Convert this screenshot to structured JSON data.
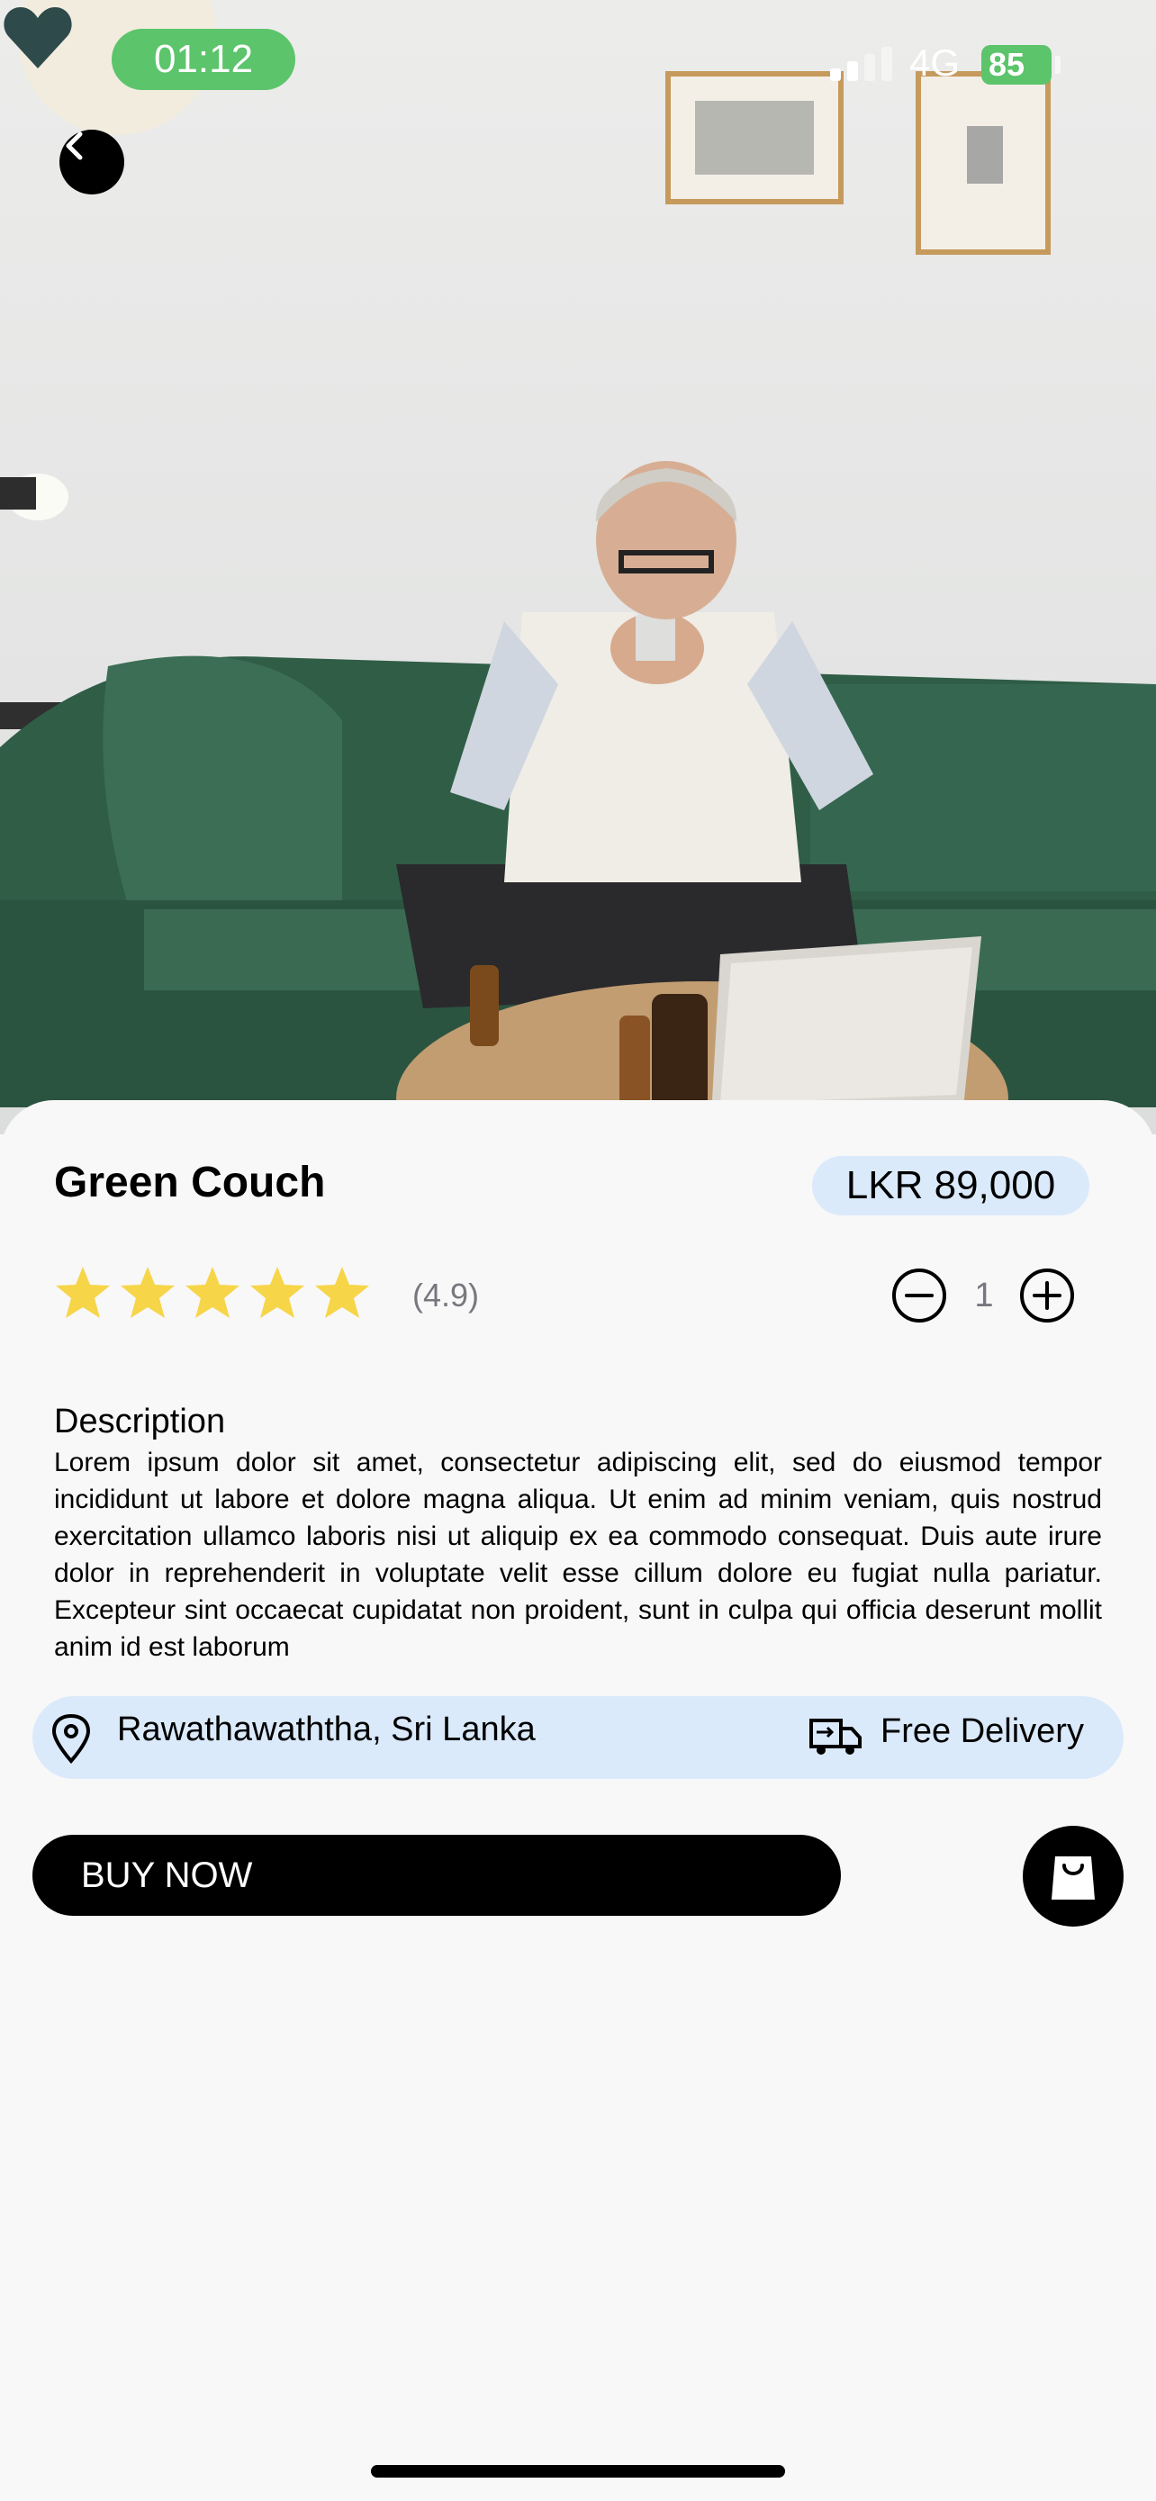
{
  "status_bar": {
    "time": "01:12",
    "network": "4G",
    "battery": "85"
  },
  "hero": {
    "back_icon": "chevron-left-icon",
    "favorite_icon": "heart-icon"
  },
  "product": {
    "title": "Green Couch",
    "price": "LKR 89,000",
    "rating_text": "(4.9)",
    "stars": 5,
    "quantity": "1"
  },
  "description": {
    "heading": "Description",
    "body": "Lorem ipsum dolor sit amet, consectetur adipiscing elit, sed do eiusmod tempor incididunt ut labore et dolore magna aliqua. Ut enim ad minim veniam, quis nostrud exercitation ullamco laboris nisi ut aliquip ex ea commodo consequat. Duis aute irure dolor in reprehenderit in voluptate velit esse cillum dolore eu fugiat nulla pariatur. Excepteur sint occaecat cupidatat non proident, sunt in culpa qui officia deserunt mollit anim id est laborum"
  },
  "info": {
    "location": "Rawathawaththa, Sri Lanka",
    "delivery": "Free Delivery"
  },
  "actions": {
    "buy_label": "BUY NOW",
    "cart_icon": "shopping-bag-icon"
  },
  "colors": {
    "status_green": "#5cc46b",
    "accent_blue": "#dbeafb",
    "star_yellow": "#f7d548",
    "heart": "#2e4a4a"
  }
}
